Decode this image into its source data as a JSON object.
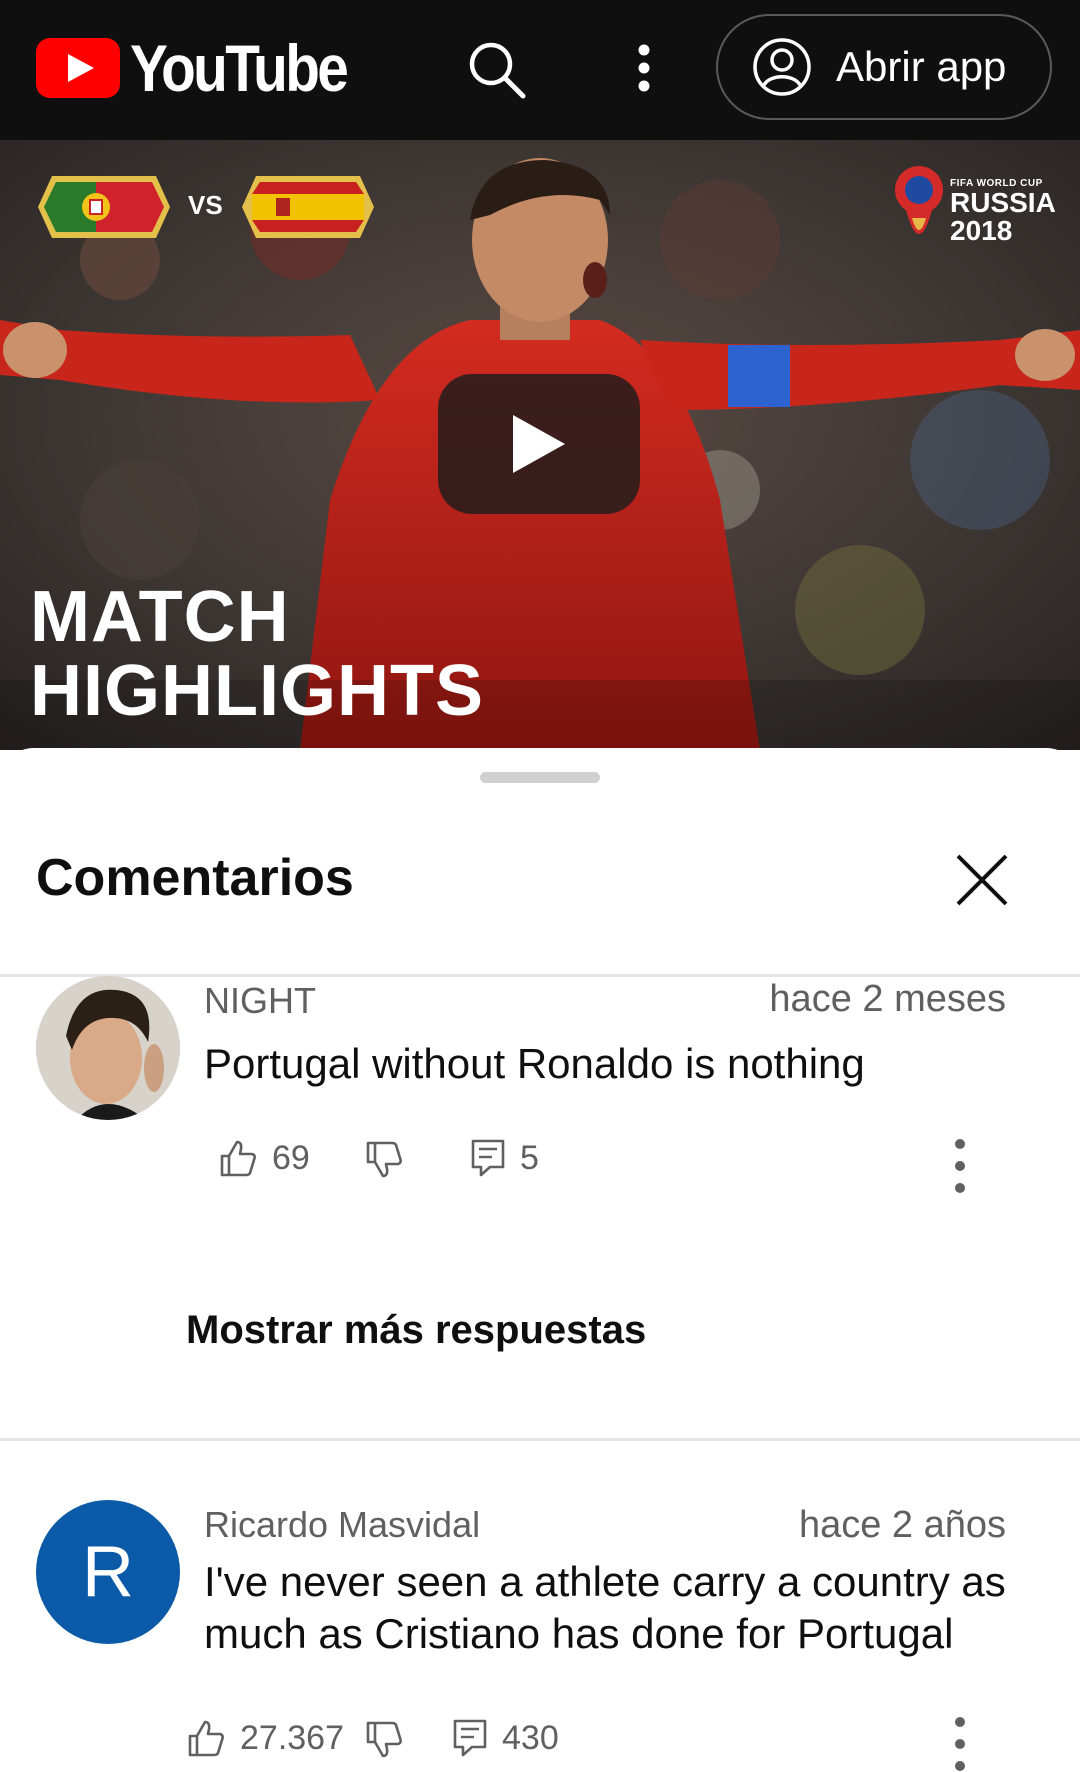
{
  "header": {
    "brand": "YouTube",
    "open_app_label": "Abrir app",
    "icons": [
      "youtube-logo-icon",
      "search-icon",
      "more-vert-icon",
      "account-circle-icon"
    ]
  },
  "video": {
    "team_vs": "VS",
    "tournament_small": "FIFA WORLD CUP",
    "tournament_line1": "RUSSIA",
    "tournament_line2": "2018",
    "title_line1": "MATCH",
    "title_line2": "HIGHLIGHTS"
  },
  "comments_panel": {
    "title": "Comentarios",
    "comments": [
      {
        "author": "NIGHT",
        "time": "hace 2 meses",
        "text": "Portugal without Ronaldo is nothing",
        "likes": "69",
        "replies": "5"
      },
      {
        "author": "Ricardo Masvidal",
        "avatar_letter": "R",
        "time": "hace 2 años",
        "text_line1": "I've never seen a athlete carry a country as",
        "text_line2": "much as Cristiano has done for Portugal",
        "likes": "27.367",
        "replies": "430"
      }
    ],
    "more_replies_label": "Mostrar más respuestas"
  },
  "colors": {
    "topbar_bg": "#0f0f0f",
    "brand_red": "#ff0000",
    "avatar_blue": "#0b5aa8",
    "secondary_text": "#606060"
  }
}
